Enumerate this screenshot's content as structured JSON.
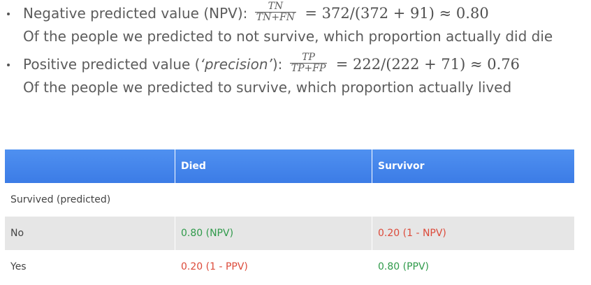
{
  "bullets": [
    {
      "label": "Negative predicted value (NPV):",
      "frac_num": "TN",
      "frac_den": "TN+FN",
      "formula": "= 372/(372 + 91) ≈ 0.80",
      "description": "Of the people we predicted to not survive, which proportion actually did die"
    },
    {
      "label_pre": "Positive predicted value (",
      "label_em": "‘precision’",
      "label_post": "):",
      "frac_num": "TP",
      "frac_den": "TP+FP",
      "formula": "= 222/(222 + 71) ≈ 0.76",
      "description": "Of the people we predicted to survive, which proportion actually lived"
    }
  ],
  "table": {
    "headers": [
      "",
      "Died",
      "Survivor"
    ],
    "rows": [
      [
        "Survived (predicted)",
        "",
        ""
      ],
      [
        "No",
        "0.80 (NPV)",
        "0.20 (1 - NPV)"
      ],
      [
        "Yes",
        "0.20 (1 - PPV)",
        "0.80 (PPV)"
      ]
    ]
  },
  "colors": {
    "header_blue": "#4a8af0",
    "good": "#2f9a4a",
    "bad": "#dc4a3a",
    "alt_row": "#e6e6e6"
  }
}
